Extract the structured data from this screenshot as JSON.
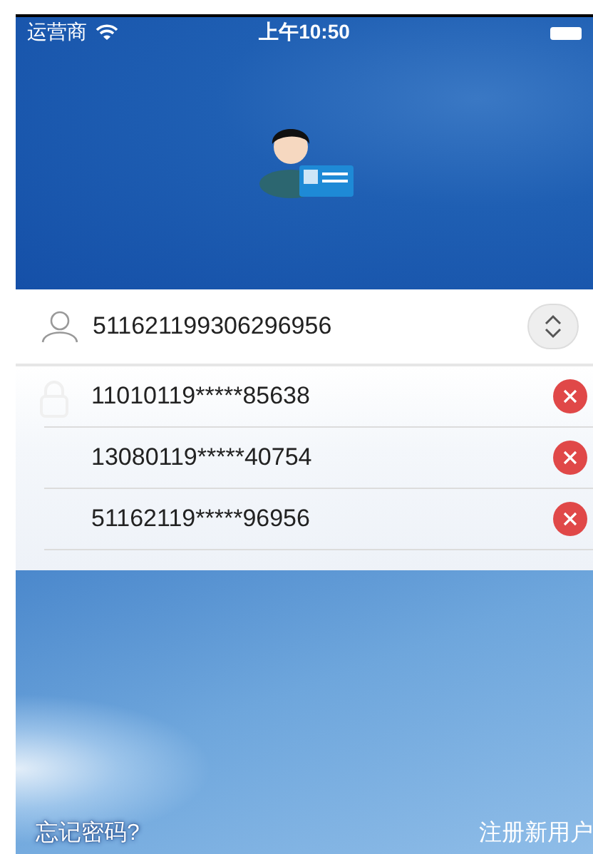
{
  "status_bar": {
    "carrier": "运营商",
    "time": "上午10:50"
  },
  "username_field": {
    "value": "511621199306296956"
  },
  "account_list": [
    {
      "account": "11010119*****85638"
    },
    {
      "account": "13080119*****40754"
    },
    {
      "account": "51162119*****96956"
    }
  ],
  "links": {
    "forgot_password": "忘记密码?",
    "register": "注册新用户"
  }
}
